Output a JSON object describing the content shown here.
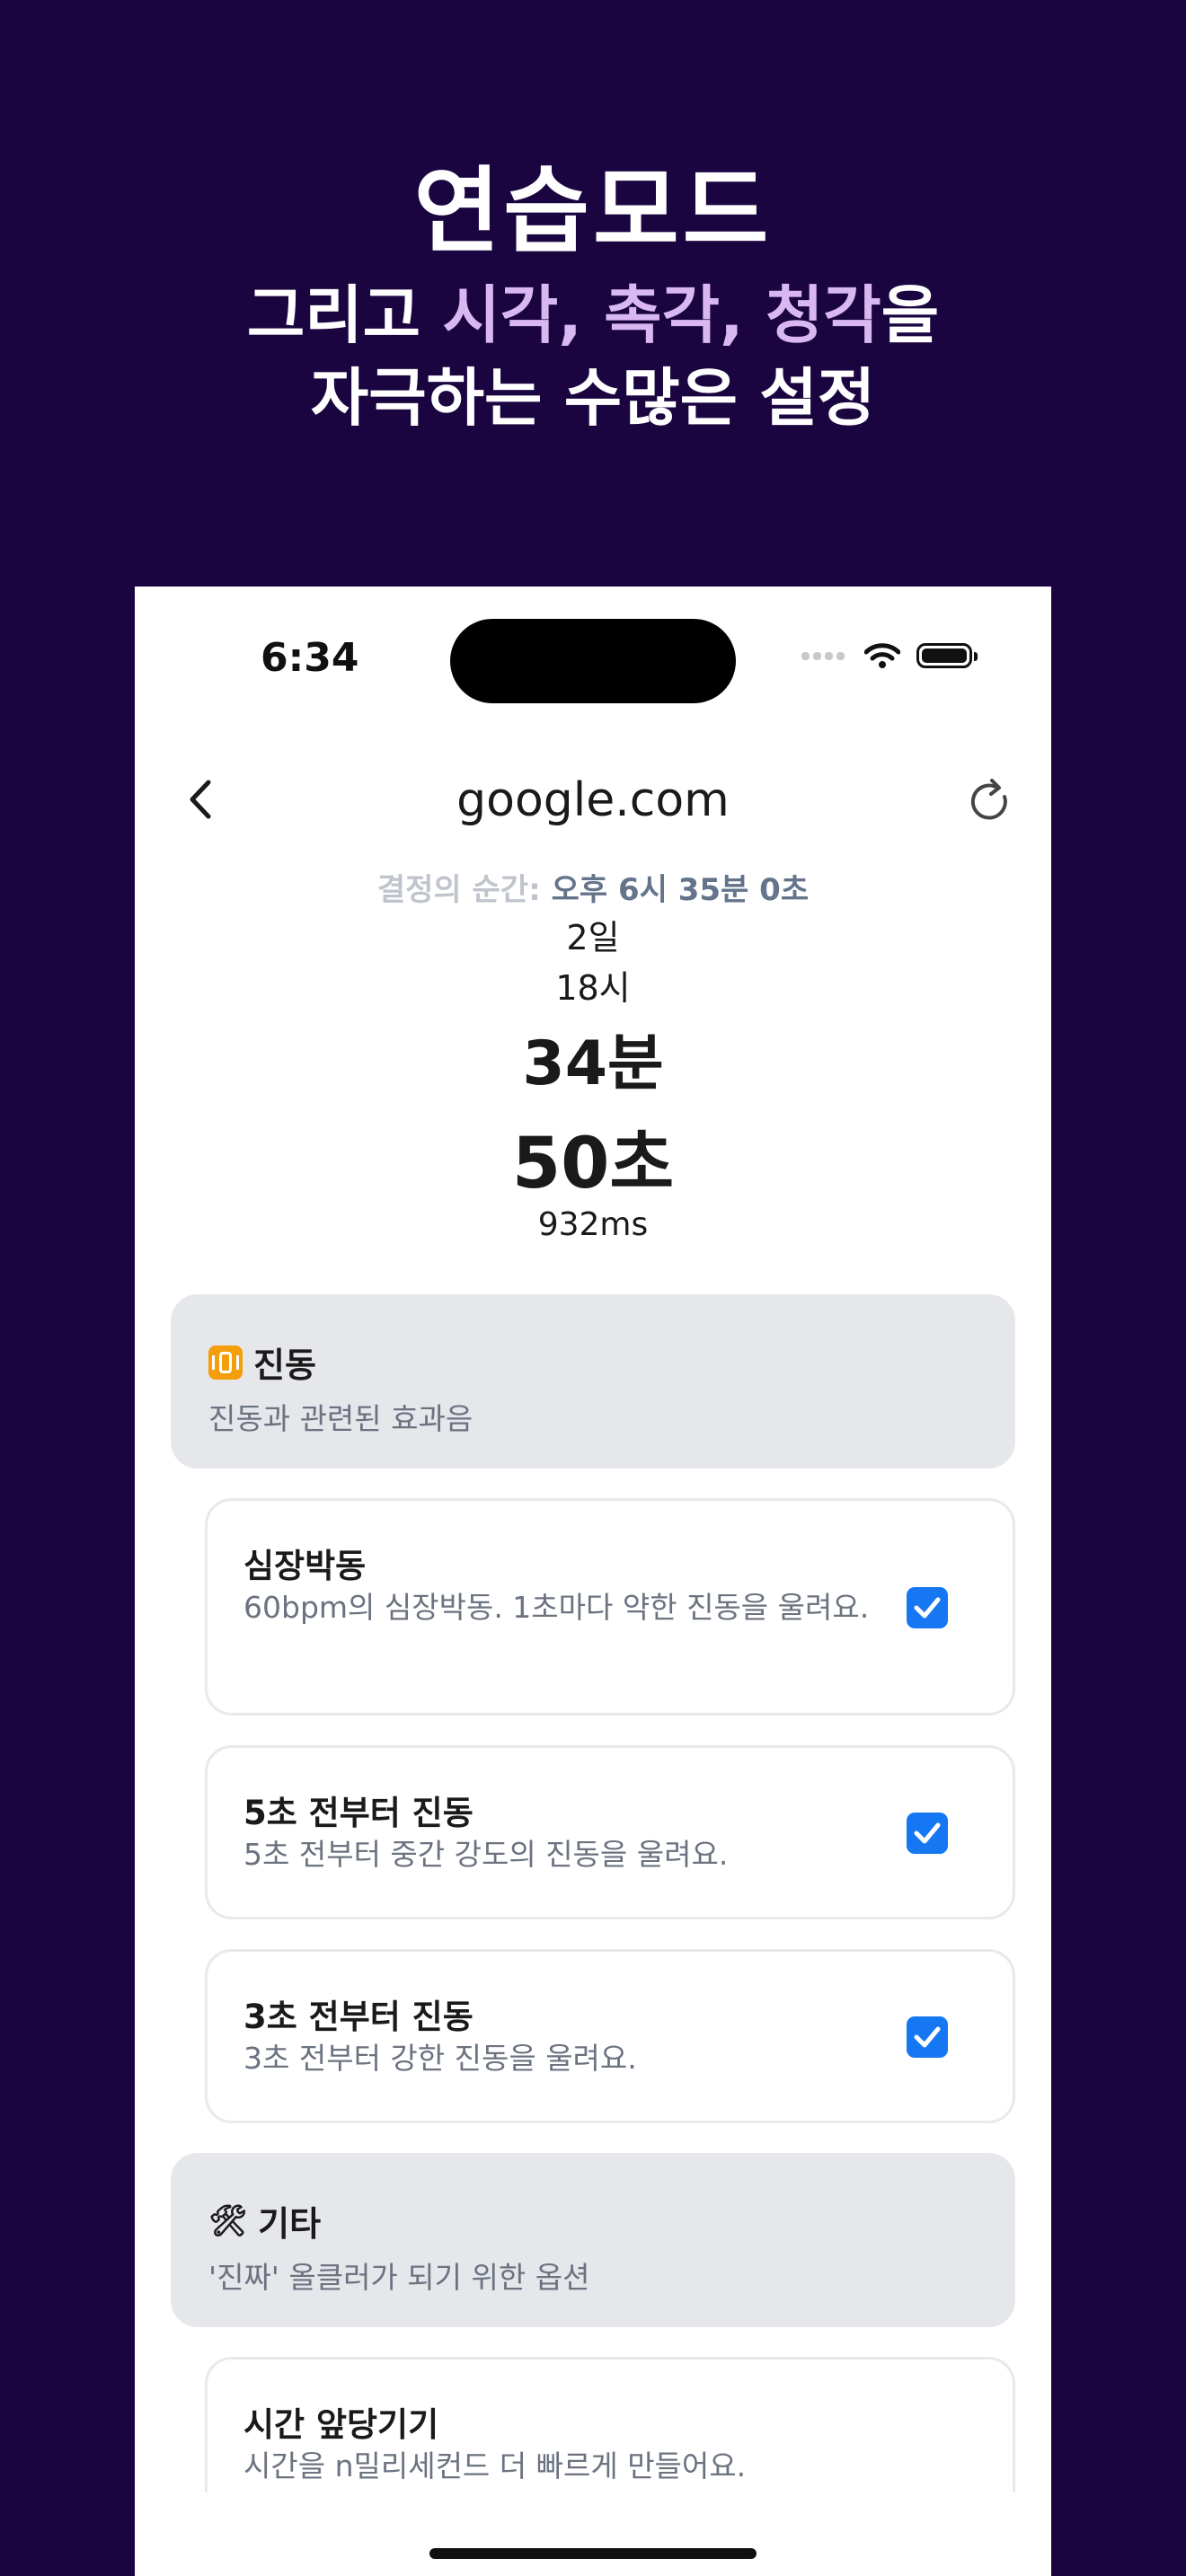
{
  "hero": {
    "title": "연습모드",
    "line1_pre": "그리고 ",
    "line1_hl": "시각, 촉각, 청각",
    "line1_post": "을",
    "line2": "자극하는 수많은 설정"
  },
  "status": {
    "time": "6:34"
  },
  "nav": {
    "title": "google.com",
    "back_icon": "chevron-left-icon",
    "reload_icon": "reload-icon"
  },
  "deadline": {
    "label": "결정의 순간:",
    "value": "오후 6시 35분 0초"
  },
  "countdown": {
    "days": "2일",
    "hours": "18시",
    "minutes": "34분",
    "seconds": "50초",
    "ms": "932ms"
  },
  "sections": [
    {
      "title": "진동",
      "desc": "진동과 관련된 효과음",
      "items": [
        {
          "title": "심장박동",
          "desc": "60bpm의 심장박동. 1초마다 약한 진동을 울려요.",
          "checked": true
        },
        {
          "title": "5초 전부터 진동",
          "desc": "5초 전부터 중간 강도의 진동을 울려요.",
          "checked": true
        },
        {
          "title": "3초 전부터 진동",
          "desc": "3초 전부터 강한 진동을 울려요.",
          "checked": true
        }
      ]
    },
    {
      "title": "기타",
      "icon": "🛠",
      "desc": "'진짜' 올클러가 되기 위한 옵션",
      "items": [
        {
          "title": "시간 앞당기기",
          "desc": "시간을 n밀리세컨드 더 빠르게 만들어요."
        }
      ]
    }
  ],
  "colors": {
    "background": "#1b0541",
    "highlight": "#d9b8f2",
    "accent": "#1677f2",
    "section_bg": "#e5e7eb"
  }
}
